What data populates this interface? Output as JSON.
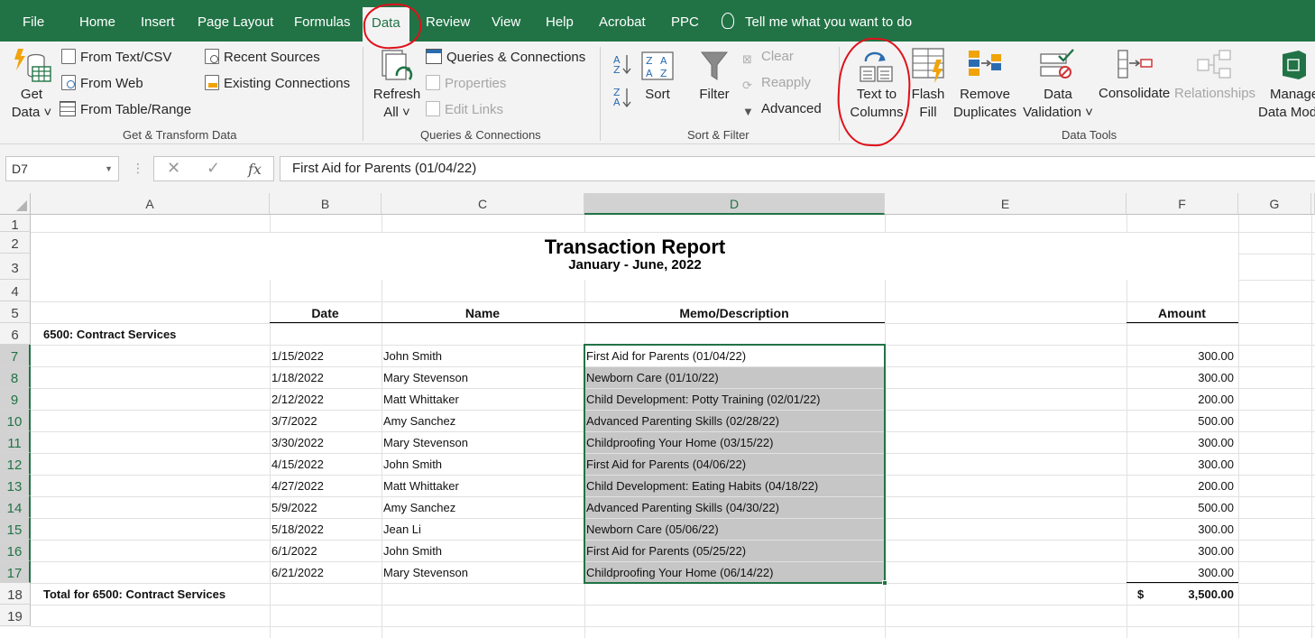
{
  "menu": {
    "tabs": [
      "File",
      "Home",
      "Insert",
      "Page Layout",
      "Formulas",
      "Data",
      "Review",
      "View",
      "Help",
      "Acrobat",
      "PPC"
    ],
    "active_tab": "Data",
    "tell_me": "Tell me what you want to do"
  },
  "ribbon": {
    "get_transform": {
      "get_data": [
        "Get",
        "Data ˅"
      ],
      "from_text_csv": "From Text/CSV",
      "from_web": "From Web",
      "from_table_range": "From Table/Range",
      "recent_sources": "Recent Sources",
      "existing_connections": "Existing Connections",
      "group_label": "Get & Transform Data"
    },
    "queries": {
      "refresh_all": [
        "Refresh",
        "All ˅"
      ],
      "queries_connections": "Queries & Connections",
      "properties": "Properties",
      "edit_links": "Edit Links",
      "group_label": "Queries & Connections"
    },
    "sort_filter": {
      "sort": "Sort",
      "filter": "Filter",
      "clear": "Clear",
      "reapply": "Reapply",
      "advanced": "Advanced",
      "group_label": "Sort & Filter"
    },
    "data_tools": {
      "text_to_columns": [
        "Text to",
        "Columns"
      ],
      "flash_fill": [
        "Flash",
        "Fill"
      ],
      "remove_duplicates": [
        "Remove",
        "Duplicates"
      ],
      "data_validation": [
        "Data",
        "Validation ˅"
      ],
      "consolidate": "Consolidate",
      "relationships": "Relationships",
      "manage_data_model": [
        "Manage",
        "Data Mod"
      ],
      "group_label": "Data Tools"
    }
  },
  "formula_bar": {
    "name_box": "D7",
    "content": "First Aid for Parents (01/04/22)"
  },
  "sheet": {
    "columns": [
      "A",
      "B",
      "C",
      "D",
      "E",
      "F",
      "G"
    ],
    "rows": [
      "1",
      "2",
      "3",
      "4",
      "5",
      "6",
      "7",
      "8",
      "9",
      "10",
      "11",
      "12",
      "13",
      "14",
      "15",
      "16",
      "17",
      "18",
      "19"
    ],
    "title": "Transaction Report",
    "subtitle": "January - June, 2022",
    "headers": {
      "date": "Date",
      "name": "Name",
      "memo": "Memo/Description",
      "amount": "Amount"
    },
    "section": "6500: Contract Services",
    "transactions": [
      {
        "date": "1/15/2022",
        "name": "John Smith",
        "memo": "First Aid for Parents (01/04/22)",
        "amount": "300.00"
      },
      {
        "date": "1/18/2022",
        "name": "Mary Stevenson",
        "memo": "Newborn Care (01/10/22)",
        "amount": "300.00"
      },
      {
        "date": "2/12/2022",
        "name": "Matt Whittaker",
        "memo": "Child Development: Potty Training (02/01/22)",
        "amount": "200.00"
      },
      {
        "date": "3/7/2022",
        "name": "Amy Sanchez",
        "memo": "Advanced Parenting Skills (02/28/22)",
        "amount": "500.00"
      },
      {
        "date": "3/30/2022",
        "name": "Mary Stevenson",
        "memo": "Childproofing Your Home (03/15/22)",
        "amount": "300.00"
      },
      {
        "date": "4/15/2022",
        "name": "John Smith",
        "memo": "First Aid for Parents (04/06/22)",
        "amount": "300.00"
      },
      {
        "date": "4/27/2022",
        "name": "Matt Whittaker",
        "memo": "Child Development: Eating Habits (04/18/22)",
        "amount": "200.00"
      },
      {
        "date": "5/9/2022",
        "name": "Amy Sanchez",
        "memo": "Advanced Parenting Skills (04/30/22)",
        "amount": "500.00"
      },
      {
        "date": "5/18/2022",
        "name": "Jean Li",
        "memo": "Newborn Care (05/06/22)",
        "amount": "300.00"
      },
      {
        "date": "6/1/2022",
        "name": "John Smith",
        "memo": "First Aid for Parents (05/25/22)",
        "amount": "300.00"
      },
      {
        "date": "6/21/2022",
        "name": "Mary Stevenson",
        "memo": "Childproofing Your Home (06/14/22)",
        "amount": "300.00"
      }
    ],
    "total_label": "Total for 6500: Contract Services",
    "total_currency": "$",
    "total_amount": "3,500.00"
  },
  "colors": {
    "excel_green": "#217346",
    "annotation_red": "#e0101a",
    "selection_gray": "#c6c6c6"
  }
}
